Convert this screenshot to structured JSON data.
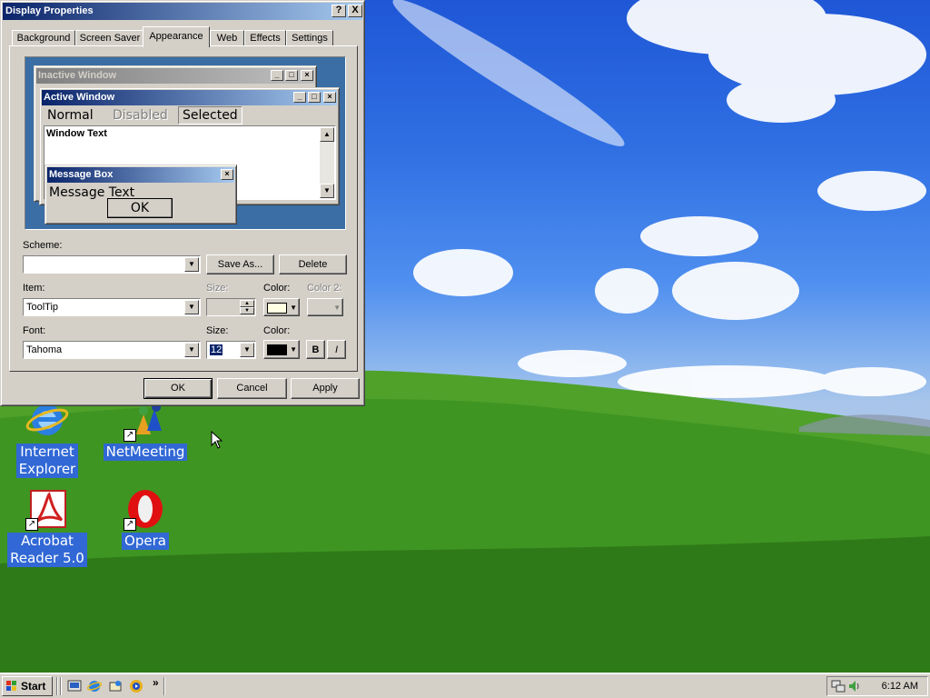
{
  "window": {
    "title": "Display Properties",
    "help_btn": "?",
    "close_btn": "X"
  },
  "tabs": [
    "Background",
    "Screen Saver",
    "Appearance",
    "Web",
    "Effects",
    "Settings"
  ],
  "preview": {
    "inactive_title": "Inactive Window",
    "active_title": "Active Window",
    "menu_normal": "Normal",
    "menu_disabled": "Disabled",
    "menu_selected": "Selected",
    "window_text": "Window Text",
    "message_title": "Message Box",
    "message_text": "Message Text",
    "message_ok": "OK"
  },
  "form": {
    "scheme_label": "Scheme:",
    "scheme_value": "",
    "save_as_label": "Save As...",
    "delete_label": "Delete",
    "item_label": "Item:",
    "item_value": "ToolTip",
    "size_label": "Size:",
    "item_size_value": "",
    "color_label": "Color:",
    "color2_label": "Color 2:",
    "item_color": "#ffffe1",
    "font_label": "Font:",
    "font_value": "Tahoma",
    "font_size_label": "Size:",
    "font_size_value": "12",
    "font_color_label": "Color:",
    "font_color": "#000000",
    "bold_label": "B",
    "italic_label": "I"
  },
  "footer": {
    "ok_label": "OK",
    "cancel_label": "Cancel",
    "apply_label": "Apply"
  },
  "desktop_icons": [
    {
      "name": "internet-explorer",
      "label_lines": [
        "Internet",
        "Explorer"
      ]
    },
    {
      "name": "netmeeting",
      "label_lines": [
        "NetMeeting"
      ]
    },
    {
      "name": "acrobat-reader",
      "label_lines": [
        "Acrobat",
        "Reader 5.0"
      ]
    },
    {
      "name": "opera",
      "label_lines": [
        "Opera"
      ]
    }
  ],
  "taskbar": {
    "start_label": "Start",
    "chevron": "»",
    "clock": "6:12 AM"
  },
  "colors": {
    "titlebar_active_start": "#0a246a",
    "titlebar_active_end": "#a6caf0",
    "desktop_preview": "#3a6ea5",
    "icon_label_bg": "#3168d5"
  }
}
